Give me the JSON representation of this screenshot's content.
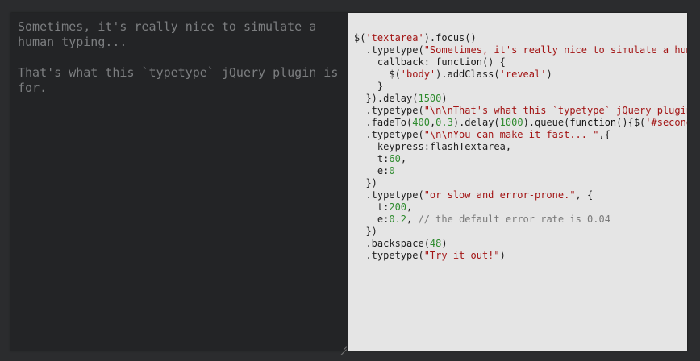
{
  "textarea": {
    "value": "Sometimes, it's really nice to simulate a\nhuman typing...\n\nThat's what this `typetype` jQuery plugin is\nfor."
  },
  "code": {
    "lines": [
      [
        {
          "t": "$("
        },
        {
          "t": "'textarea'",
          "c": "str"
        },
        {
          "t": ").focus()"
        }
      ],
      [
        {
          "t": "  .typetype("
        },
        {
          "t": "\"Sometimes, it's really nice to simulate a human typing...\"",
          "c": "str"
        },
        {
          "t": ", {"
        }
      ],
      [
        {
          "t": "    callback: "
        },
        {
          "t": "function",
          "c": "kw"
        },
        {
          "t": "() {"
        }
      ],
      [
        {
          "t": "      $("
        },
        {
          "t": "'body'",
          "c": "str"
        },
        {
          "t": ").addClass("
        },
        {
          "t": "'reveal'",
          "c": "str"
        },
        {
          "t": ")"
        }
      ],
      [
        {
          "t": "    }"
        }
      ],
      [
        {
          "t": "  }).delay("
        },
        {
          "t": "1500",
          "c": "num"
        },
        {
          "t": ")"
        }
      ],
      [
        {
          "t": "  .typetype("
        },
        {
          "t": "\"\\n\\nThat's what this `typetype` jQuery plugin is for.\"",
          "c": "str"
        },
        {
          "t": ")"
        }
      ],
      [
        {
          "t": "  .fadeTo("
        },
        {
          "t": "400",
          "c": "num"
        },
        {
          "t": ","
        },
        {
          "t": "0.3",
          "c": "num"
        },
        {
          "t": ").delay("
        },
        {
          "t": "1000",
          "c": "num"
        },
        {
          "t": ").queue("
        },
        {
          "t": "function",
          "c": "kw"
        },
        {
          "t": "(){$("
        },
        {
          "t": "'#secondBox'",
          "c": "str"
        },
        {
          "t": ")"
        }
      ],
      [
        {
          "t": "  .typetype("
        },
        {
          "t": "\"\\n\\nYou can make it fast... \"",
          "c": "str"
        },
        {
          "t": ",{"
        }
      ],
      [
        {
          "t": "    keypress:flashTextarea,"
        }
      ],
      [
        {
          "t": "    t:"
        },
        {
          "t": "60",
          "c": "num"
        },
        {
          "t": ","
        }
      ],
      [
        {
          "t": "    e:"
        },
        {
          "t": "0",
          "c": "num"
        }
      ],
      [
        {
          "t": "  })"
        }
      ],
      [
        {
          "t": "  .typetype("
        },
        {
          "t": "\"or slow and error-prone.\"",
          "c": "str"
        },
        {
          "t": ", {"
        }
      ],
      [
        {
          "t": "    t:"
        },
        {
          "t": "200",
          "c": "num"
        },
        {
          "t": ","
        }
      ],
      [
        {
          "t": "    e:"
        },
        {
          "t": "0.2",
          "c": "num"
        },
        {
          "t": ", "
        },
        {
          "t": "// the default error rate is 0.04",
          "c": "cmt"
        }
      ],
      [
        {
          "t": "  })"
        }
      ],
      [
        {
          "t": "  .backspace("
        },
        {
          "t": "48",
          "c": "num"
        },
        {
          "t": ")"
        }
      ],
      [
        {
          "t": "  .typetype("
        },
        {
          "t": "\"Try it out!\"",
          "c": "str"
        },
        {
          "t": ")"
        }
      ]
    ]
  }
}
